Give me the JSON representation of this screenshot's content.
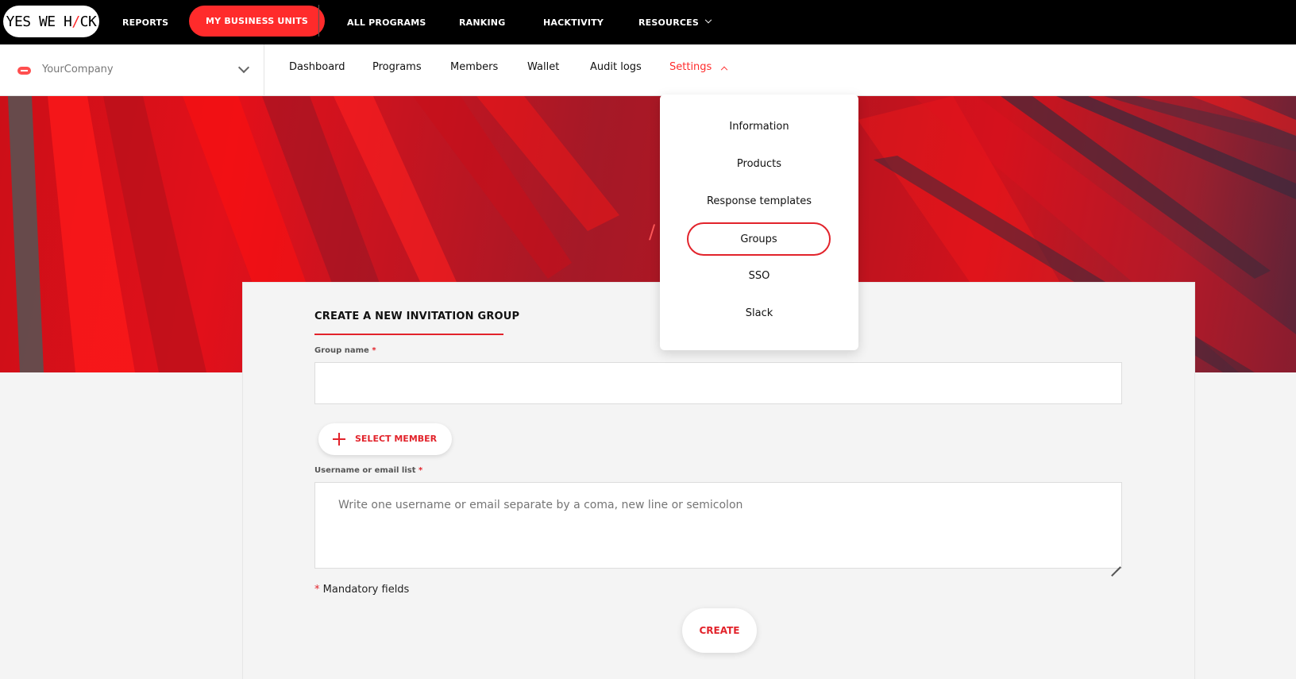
{
  "brand": {
    "logo_left": "YES WE H",
    "logo_slash": "/",
    "logo_right": "CK",
    "accent": "#ff2b2b"
  },
  "topnav": {
    "items": [
      {
        "label": "REPORTS"
      },
      {
        "label": "MY BUSINESS UNITS",
        "active": true
      },
      {
        "label": "ALL PROGRAMS"
      },
      {
        "label": "RANKING"
      },
      {
        "label": "HACKTIVITY"
      },
      {
        "label": "RESOURCES",
        "dropdown": true
      }
    ]
  },
  "company": {
    "name": "YourCompany",
    "icon": "company-logo-icon"
  },
  "subnav": {
    "items": [
      {
        "label": "Dashboard"
      },
      {
        "label": "Programs"
      },
      {
        "label": "Members"
      },
      {
        "label": "Wallet"
      },
      {
        "label": "Audit logs"
      },
      {
        "label": "Settings",
        "active": true,
        "expanded": true
      }
    ]
  },
  "hero": {
    "breadcrumb_slash": "/"
  },
  "settings_menu": {
    "items": [
      {
        "label": "Information"
      },
      {
        "label": "Products"
      },
      {
        "label": "Response templates"
      },
      {
        "label": "Groups",
        "selected": true
      },
      {
        "label": "SSO"
      },
      {
        "label": "Slack"
      }
    ]
  },
  "form": {
    "title": "CREATE A NEW INVITATION GROUP",
    "group_name_label": "Group name",
    "required_mark": "*",
    "group_name_value": "",
    "select_member_label": "SELECT MEMBER",
    "userlist_label": "Username or email list",
    "userlist_placeholder": "Write one username or email separate by a coma, new line or semicolon",
    "mandatory_note": "Mandatory fields",
    "create_label": "CREATE"
  }
}
